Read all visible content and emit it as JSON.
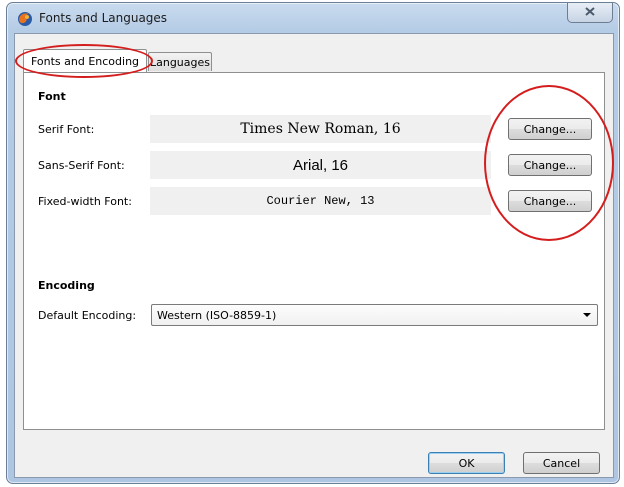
{
  "window": {
    "title": "Fonts and Languages",
    "close_glyph": "☒",
    "icon": "firefox-icon"
  },
  "tabs": [
    {
      "label": "Fonts and Encoding",
      "active": true
    },
    {
      "label": "Languages",
      "active": false
    }
  ],
  "font_section": {
    "title": "Font",
    "rows": [
      {
        "label": "Serif Font:",
        "value": "Times New Roman, 16",
        "button": "Change..."
      },
      {
        "label": "Sans-Serif Font:",
        "value": "Arial, 16",
        "button": "Change..."
      },
      {
        "label": "Fixed-width Font:",
        "value": "Courier New, 13",
        "button": "Change..."
      }
    ]
  },
  "encoding_section": {
    "title": "Encoding",
    "default_label": "Default Encoding:",
    "default_value": "Western (ISO-8859-1)"
  },
  "footer": {
    "ok_label": "OK",
    "cancel_label": "Cancel"
  },
  "colors": {
    "annotation": "#d41e1e",
    "titlebar": "#b5cce6"
  }
}
